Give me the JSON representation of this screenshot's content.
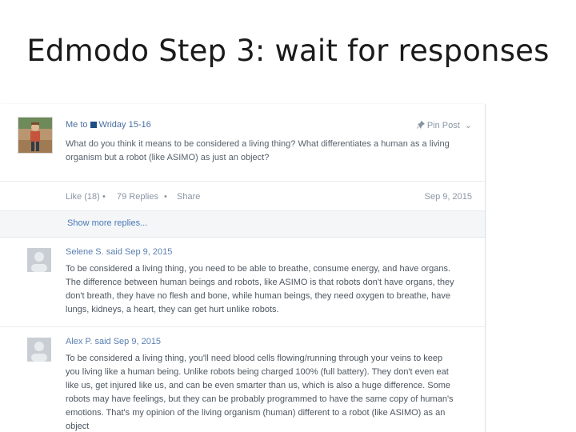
{
  "slide": {
    "title": "Edmodo Step 3:  wait for responses"
  },
  "post": {
    "sender": "Me to",
    "group": "Wriday 15-16",
    "pin_label": "Pin Post",
    "text": "What do you think it means to be considered a living thing? What differentiates a human as a living organism but a robot (like ASIMO) as just an object?",
    "like": "Like (18)",
    "replies": "79 Replies",
    "share": "Share",
    "date": "Sep 9, 2015",
    "icons": [
      "user-photo",
      "pin-icon",
      "chevron-down-icon"
    ]
  },
  "show_more": "Show more replies...",
  "replies": [
    {
      "author": "Selene S. said Sep 9, 2015",
      "text": "To be considered a living thing, you need to be able to breathe, consume energy, and have organs. The difference between human beings and robots, like ASIMO is that robots don't have organs, they don't breath, they have no flesh and bone, while human beings, they need oxygen to breathe, have lungs, kidneys, a heart, they can get hurt unlike robots."
    },
    {
      "author": "Alex P. said Sep 9, 2015",
      "text": "To be considered a living thing, you'll need blood cells flowing/running through your veins to keep you living like a human being. Unlike robots being charged 100% (full battery). They don't even eat like us, get injured like us, and can be even smarter than us, which is also a huge difference. Some robots may have feelings, but they can be probably programmed to have the same copy of human's emotions. That's my opinion of the living organism (human) different to a robot (like ASIMO) as an object"
    }
  ],
  "colors": {
    "link": "#4a78b5",
    "muted": "#8a95a3",
    "group_square": "#1f4e86",
    "placeholder_avatar": "#c9ced4"
  }
}
